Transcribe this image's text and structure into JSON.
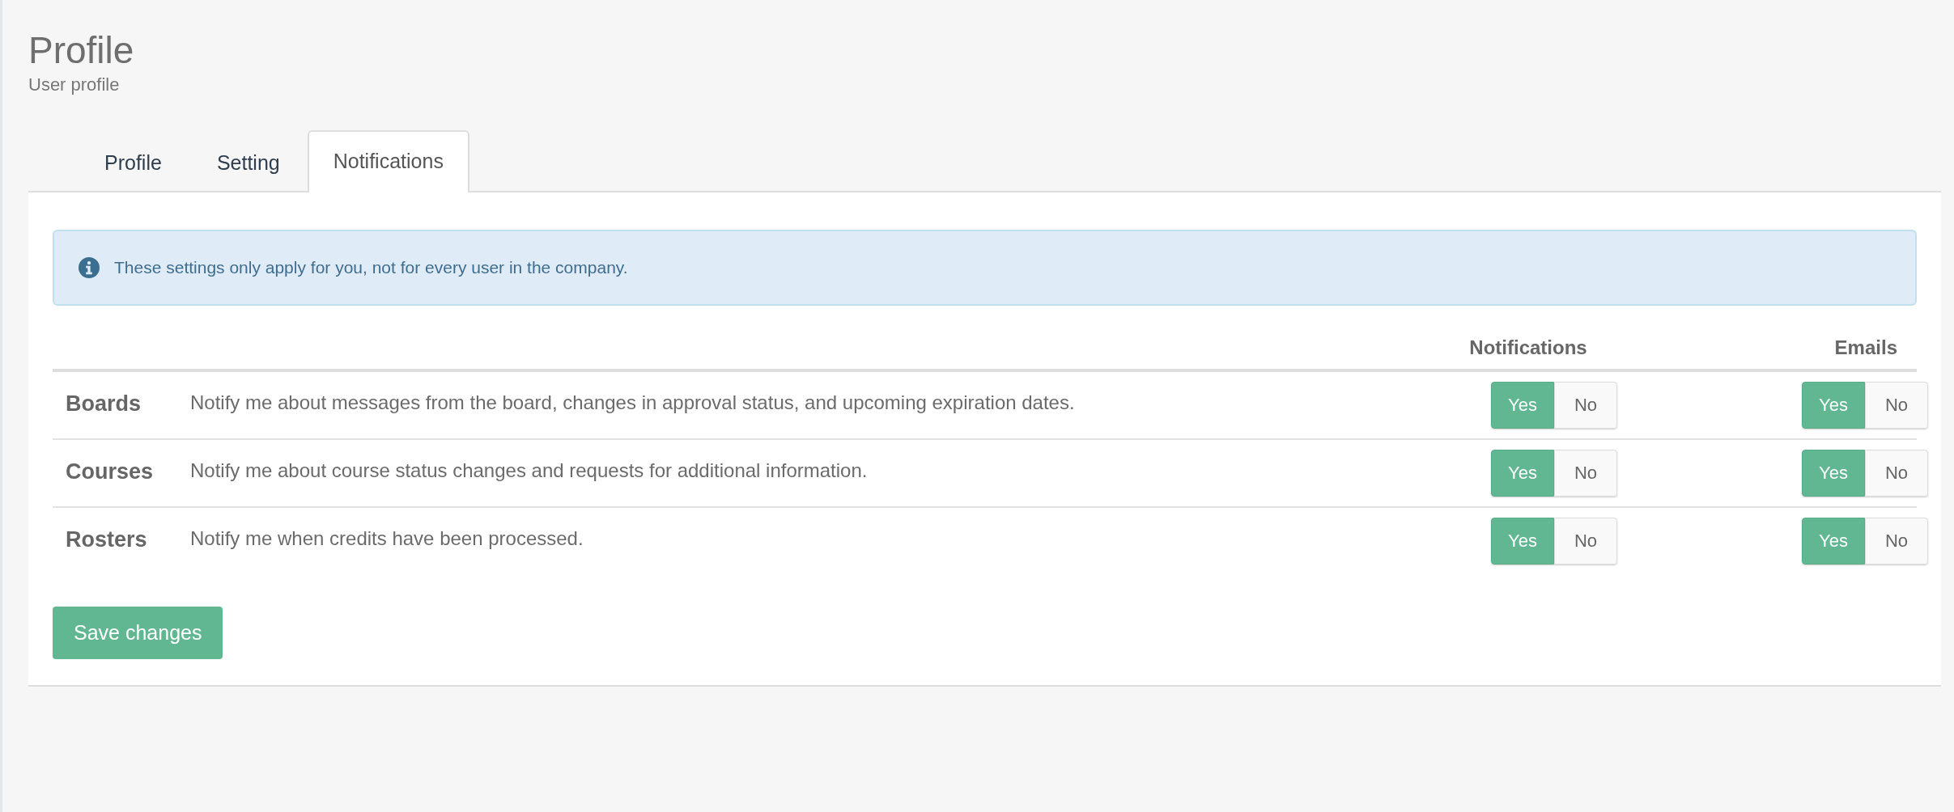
{
  "header": {
    "title": "Profile",
    "subtitle": "User profile"
  },
  "tabs": [
    {
      "label": "Profile",
      "selected": false
    },
    {
      "label": "Setting",
      "selected": false
    },
    {
      "label": "Notifications",
      "selected": true
    }
  ],
  "alert": {
    "text": "These settings only apply for you, not for every user in the company."
  },
  "table": {
    "columns": [
      "Notifications",
      "Emails"
    ],
    "rows": [
      {
        "label": "Boards",
        "description": "Notify me about messages from the board, changes in approval status, and upcoming expiration dates.",
        "notifications": [
          {
            "label": "Yes",
            "selected": true
          },
          {
            "label": "No",
            "selected": false
          }
        ],
        "emails": [
          {
            "label": "Yes",
            "selected": true
          },
          {
            "label": "No",
            "selected": false
          }
        ]
      },
      {
        "label": "Courses",
        "description": "Notify me about course status changes and requests for additional information.",
        "notifications": [
          {
            "label": "Yes",
            "selected": true
          },
          {
            "label": "No",
            "selected": false
          }
        ],
        "emails": [
          {
            "label": "Yes",
            "selected": true
          },
          {
            "label": "No",
            "selected": false
          }
        ]
      },
      {
        "label": "Rosters",
        "description": "Notify me when credits have been processed.",
        "notifications": [
          {
            "label": "Yes",
            "selected": true
          },
          {
            "label": "No",
            "selected": false
          }
        ],
        "emails": [
          {
            "label": "Yes",
            "selected": true
          },
          {
            "label": "No",
            "selected": false
          }
        ]
      }
    ]
  },
  "save_button": "Save changes"
}
